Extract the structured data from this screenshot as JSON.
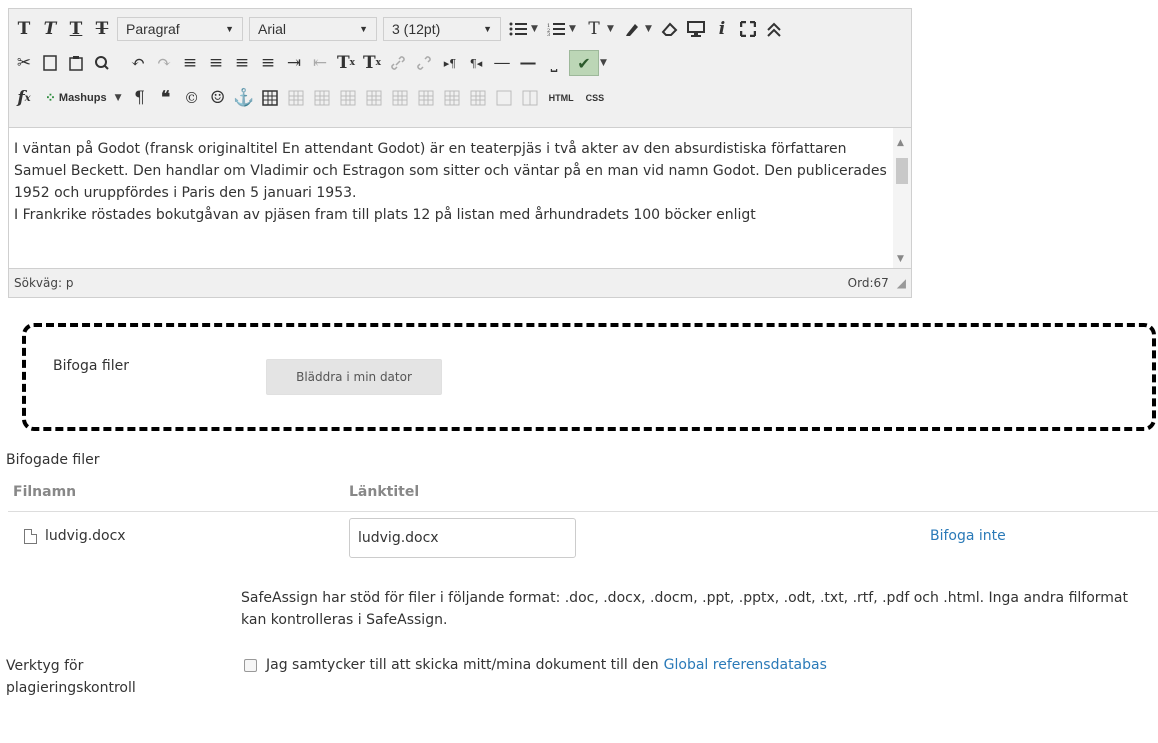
{
  "toolbar": {
    "row1": {
      "format_block": "Paragraf",
      "font_family": "Arial",
      "font_size": "3 (12pt)"
    },
    "row3": {
      "mashups_label": "Mashups",
      "html_label": "HTML",
      "css_label": "CSS"
    }
  },
  "editor": {
    "paragraphs": [
      "I väntan på Godot (fransk originaltitel En attendant Godot) är en teaterpjäs i två akter av den absurdistiska författaren Samuel Beckett. Den handlar om Vladimir och Estragon som sitter och väntar på en man vid namn Godot. Den publicerades 1952 och uruppfördes i Paris den 5 januari 1953.",
      "I Frankrike röstades bokutgåvan av pjäsen fram till plats 12 på listan med århundradets 100 böcker enligt"
    ],
    "path_label": "Sökväg: p",
    "word_count": "Ord:67"
  },
  "attach": {
    "label": "Bifoga filer",
    "browse_button": "Bläddra i min dator"
  },
  "attached_files": {
    "heading": "Bifogade filer",
    "col_filename": "Filnamn",
    "col_link_title": "Länktitel",
    "rows": [
      {
        "filename": "ludvig.docx",
        "link_title": "ludvig.docx",
        "action": "Bifoga inte"
      }
    ]
  },
  "safeassign": {
    "note": "SafeAssign har stöd för filer i följande format: .doc, .docx, .docm, .ppt, .pptx, .odt, .txt, .rtf, .pdf och .html. Inga andra filformat kan kontrolleras i SafeAssign.",
    "tool_label_line1": "Verktyg för",
    "tool_label_line2": "plagieringskontroll",
    "consent_text": "Jag samtycker till att skicka mitt/mina dokument till den",
    "consent_link": "Global referensdatabas"
  },
  "colors": {
    "link": "#2a7ab8",
    "toolbar_bg": "#f0f0f0",
    "dashed_border": "#000000"
  }
}
